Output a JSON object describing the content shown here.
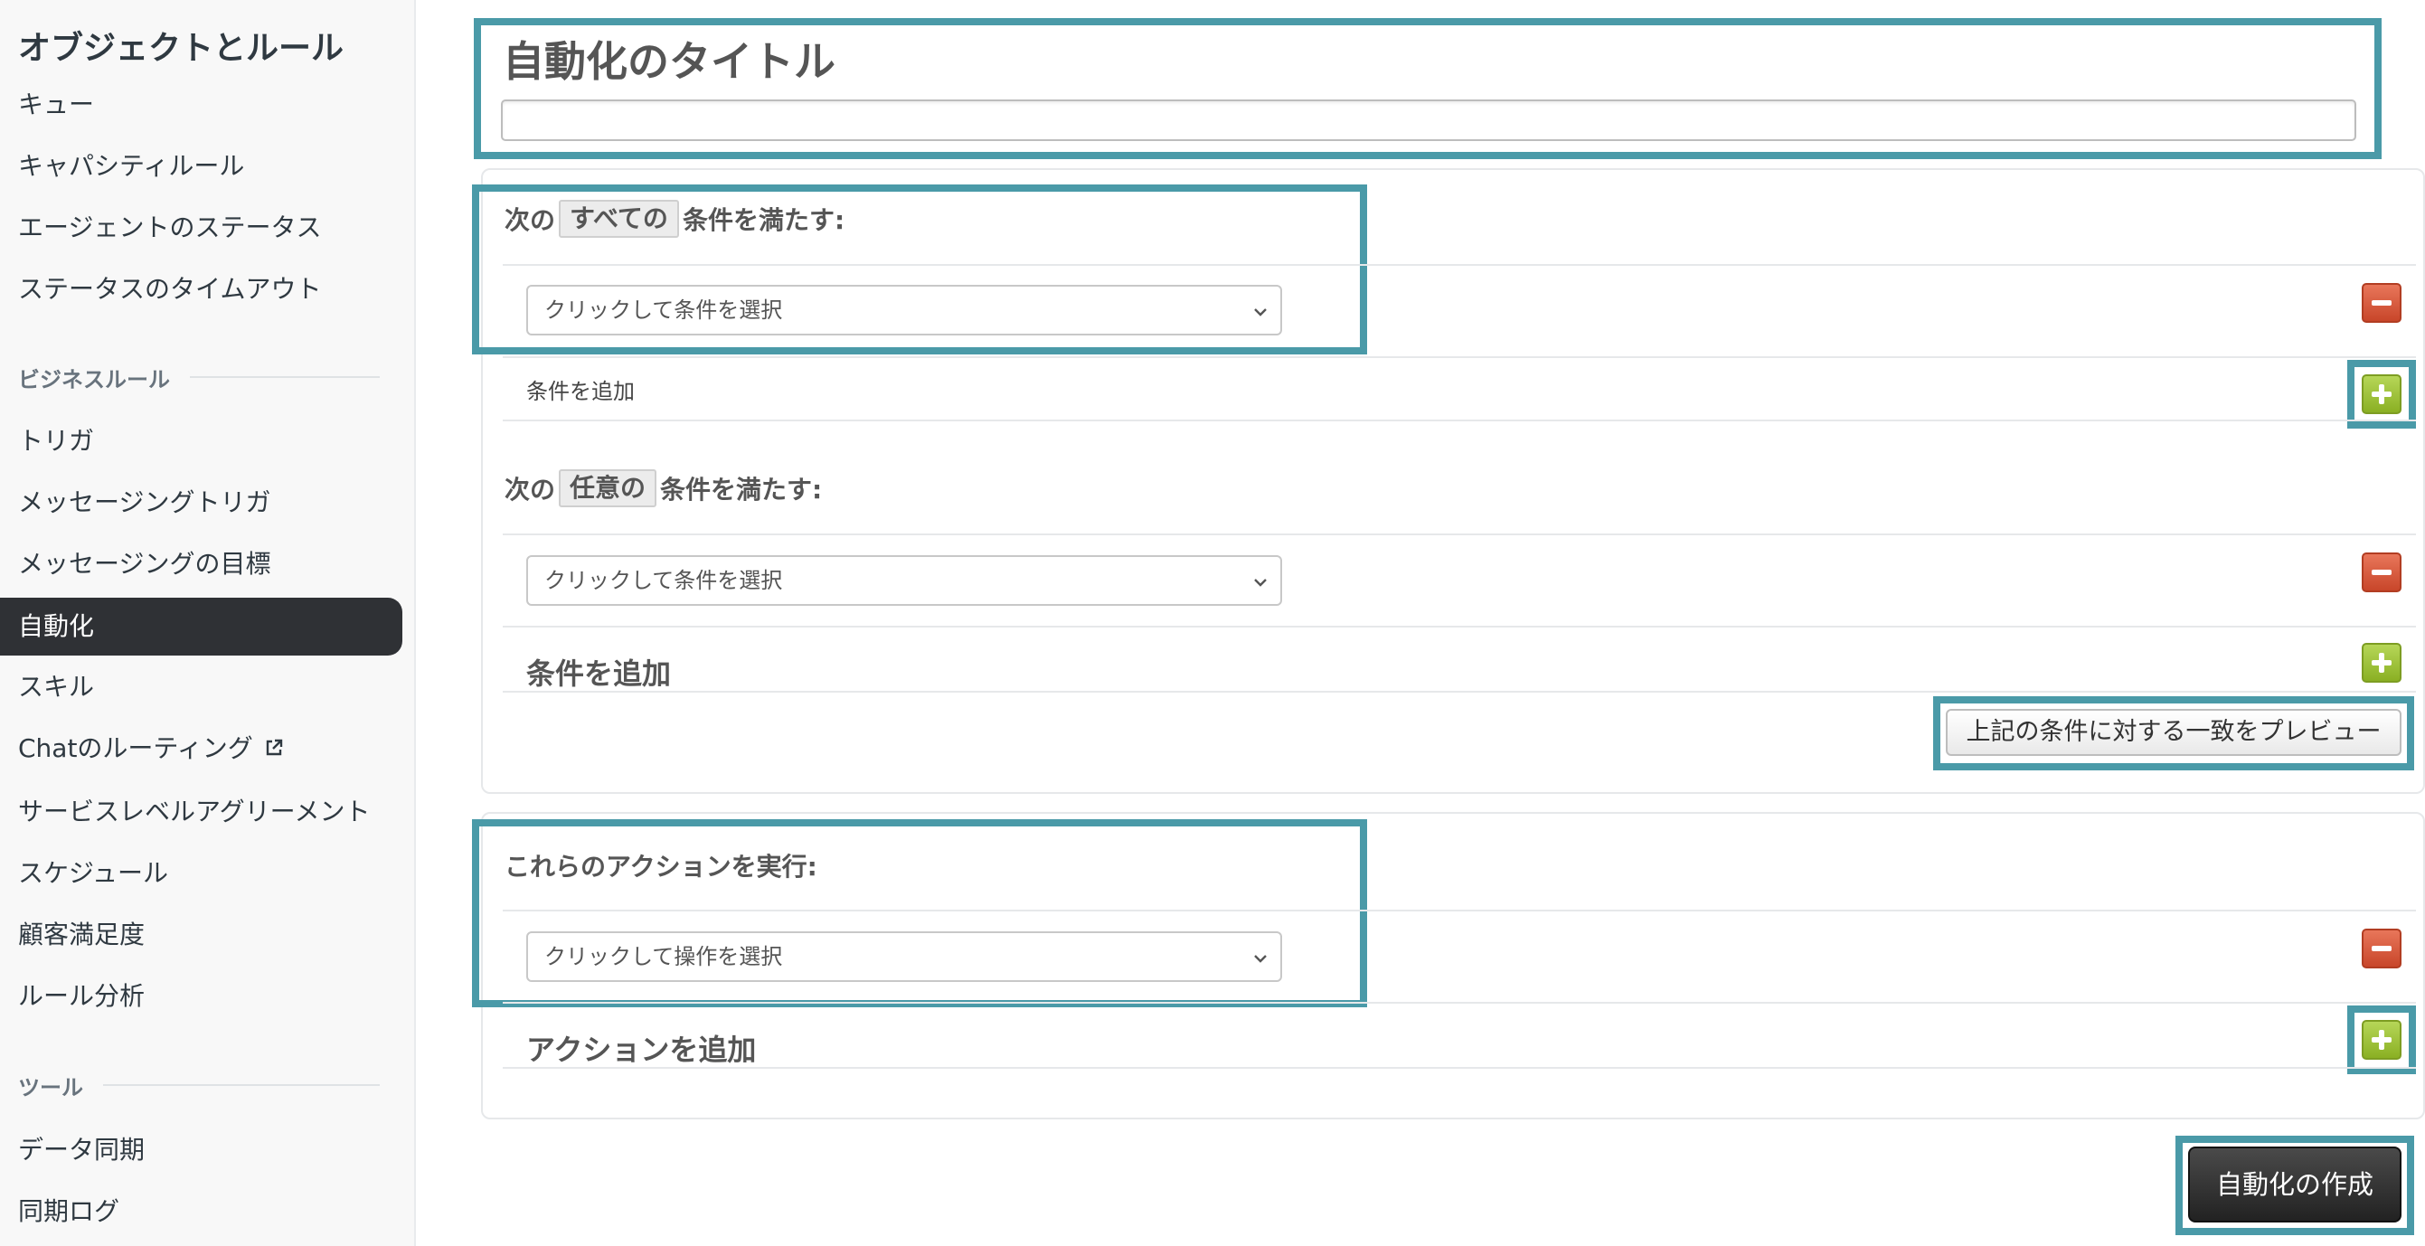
{
  "sidebar": {
    "title": "オブジェクトとルール",
    "items_top": [
      {
        "label": "キュー"
      },
      {
        "label": "キャパシティルール"
      },
      {
        "label": "エージェントのステータス"
      },
      {
        "label": "ステータスのタイムアウト"
      }
    ],
    "section_business": "ビジネスルール",
    "items_business": [
      {
        "label": "トリガ"
      },
      {
        "label": "メッセージングトリガ"
      },
      {
        "label": "メッセージングの目標"
      },
      {
        "label": "自動化",
        "active": true
      },
      {
        "label": "スキル"
      },
      {
        "label": "Chatのルーティング",
        "icon": "external-link-icon"
      },
      {
        "label": "サービスレベルアグリーメント"
      },
      {
        "label": "スケジュール"
      },
      {
        "label": "顧客満足度"
      },
      {
        "label": "ルール分析"
      }
    ],
    "section_tools": "ツール",
    "items_tools": [
      {
        "label": "データ同期"
      },
      {
        "label": "同期ログ"
      }
    ]
  },
  "form": {
    "title_label": "自動化のタイトル",
    "title_value": "",
    "all_conditions": {
      "prefix": "次の",
      "chip": "すべての",
      "suffix": "条件を満たす:",
      "select_placeholder": "クリックして条件を選択",
      "add_label": "条件を追加"
    },
    "any_conditions": {
      "prefix": "次の",
      "chip": "任意の",
      "suffix": "条件を満たす:",
      "select_placeholder": "クリックして条件を選択",
      "add_label": "条件を追加"
    },
    "preview_button": "上記の条件に対する一致をプレビュー",
    "actions": {
      "heading": "これらのアクションを実行:",
      "select_placeholder": "クリックして操作を選択",
      "add_label": "アクションを追加"
    },
    "create_button": "自動化の作成"
  },
  "colors": {
    "highlight": "#4a9aa8",
    "sidebar_active_bg": "#2f3135",
    "minus_button": "#d2553a",
    "plus_button": "#9bc23a"
  }
}
